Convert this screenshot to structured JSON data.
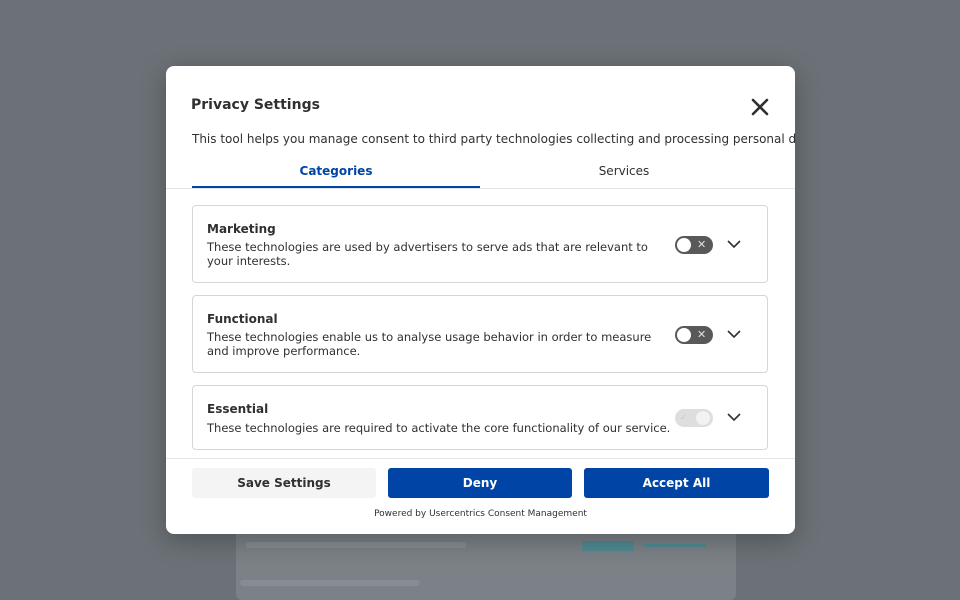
{
  "dialog": {
    "title": "Privacy Settings",
    "description": "This tool helps you manage consent to third party technologies collecting and processing personal data.",
    "close_icon": "close-icon"
  },
  "tabs": [
    {
      "label": "Categories",
      "active": true
    },
    {
      "label": "Services",
      "active": false
    }
  ],
  "categories": [
    {
      "title": "Marketing",
      "description": "These technologies are used by advertisers to serve ads that are relevant to your interests.",
      "toggle": "off"
    },
    {
      "title": "Functional",
      "description": "These technologies enable us to analyse usage behavior in order to measure and improve performance.",
      "toggle": "off"
    },
    {
      "title": "Essential",
      "description": "These technologies are required to activate the core functionality of our service.",
      "toggle": "on-disabled"
    }
  ],
  "buttons": {
    "save": "Save Settings",
    "deny": "Deny",
    "accept": "Accept All"
  },
  "footer": {
    "powered_by": "Powered by Usercentrics Consent Management"
  },
  "colors": {
    "accent": "#0045a5",
    "overlay": "#6b7176",
    "toggle_off": "#595959"
  }
}
